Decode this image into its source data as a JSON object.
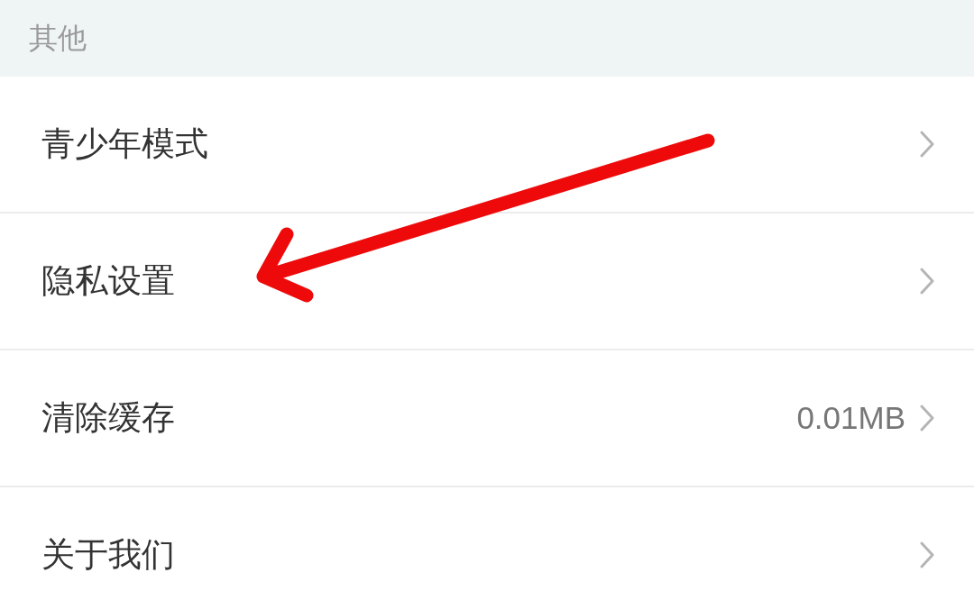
{
  "section_title": "其他",
  "items": [
    {
      "label": "青少年模式"
    },
    {
      "label": "隐私设置"
    },
    {
      "label": "清除缓存",
      "value": "0.01MB"
    },
    {
      "label": "关于我们"
    }
  ]
}
